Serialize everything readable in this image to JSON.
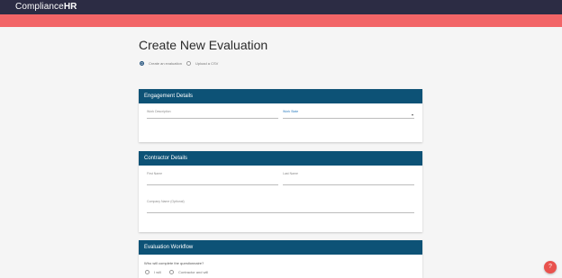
{
  "app": {
    "logo_text": "Compliance",
    "logo_bold": "HR"
  },
  "page": {
    "title": "Create New Evaluation"
  },
  "mode_options": [
    {
      "label": "Create an evaluation",
      "selected": true
    },
    {
      "label": "Upload a CSV",
      "selected": false
    }
  ],
  "engagement": {
    "header": "Engagement Details",
    "work_description_label": "Work Description",
    "work_state_label": "Work State"
  },
  "contractor": {
    "header": "Contractor Details",
    "first_name_label": "First Name",
    "last_name_label": "Last Name",
    "company_name_label": "Company Name (Optional)"
  },
  "workflow": {
    "header": "Evaluation Workflow",
    "question": "Who will complete the questionnaire?",
    "options": [
      {
        "label": "I will",
        "selected": false
      },
      {
        "label": "Contractor and will",
        "selected": false
      }
    ]
  },
  "help": {
    "label": "?"
  },
  "colors": {
    "topbar": "#2c2c44",
    "accent_red": "#f26567",
    "section_header": "#0d5276",
    "help_button": "#e9524d"
  }
}
